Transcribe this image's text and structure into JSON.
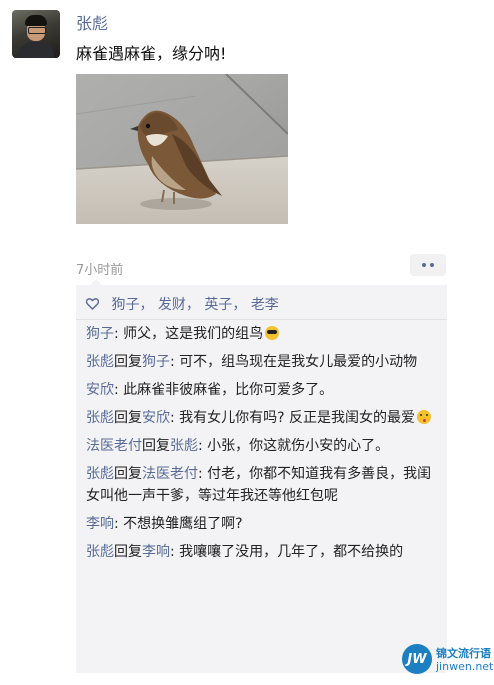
{
  "post": {
    "author": "张彪",
    "text": "麻雀遇麻雀，缘分呐!",
    "time": "7小时前",
    "avatar_icon": "user-avatar",
    "photo_icon": "sparrow-photo",
    "more_icon": "more-dots-icon"
  },
  "likes": {
    "icon": "heart-icon",
    "names": [
      "狗子",
      "发财",
      "英子",
      "老李"
    ],
    "separator": "，"
  },
  "comments": [
    {
      "author": "狗子",
      "reply_word": "",
      "reply_to": "",
      "text": ": 师父，这是我们的组鸟",
      "emoji": "sunglasses-emoji"
    },
    {
      "author": "张彪",
      "reply_word": "回复",
      "reply_to": "狗子",
      "text": ": 可不，组鸟现在是我女儿最爱的小动物",
      "emoji": ""
    },
    {
      "author": "安欣",
      "reply_word": "",
      "reply_to": "",
      "text": ": 此麻雀非彼麻雀，比你可爱多了。",
      "emoji": ""
    },
    {
      "author": "张彪",
      "reply_word": "回复",
      "reply_to": "安欣",
      "text": ": 我有女儿你有吗? 反正是我闺女的最爱",
      "emoji": "kiss-emoji"
    },
    {
      "author": "法医老付",
      "reply_word": "回复",
      "reply_to": "张彪",
      "text": ": 小张，你这就伤小安的心了。",
      "emoji": ""
    },
    {
      "author": "张彪",
      "reply_word": "回复",
      "reply_to": "法医老付",
      "text": ": 付老，你都不知道我有多善良，我闺女叫他一声干爹，等过年我还等他红包呢",
      "emoji": ""
    },
    {
      "author": "李响",
      "reply_word": "",
      "reply_to": "",
      "text": ": 不想换雏鹰组了啊?",
      "emoji": ""
    },
    {
      "author": "张彪",
      "reply_word": "回复",
      "reply_to": "李响",
      "text": ": 我嚷嚷了没用，几年了，都不给换的",
      "emoji": ""
    }
  ],
  "watermark": {
    "logo": "JW",
    "line1": "锦文流行语",
    "line2": "jinwen.net"
  },
  "colors": {
    "name": "#576b95",
    "panel": "#f3f3f5",
    "time": "#9a9a9a"
  }
}
